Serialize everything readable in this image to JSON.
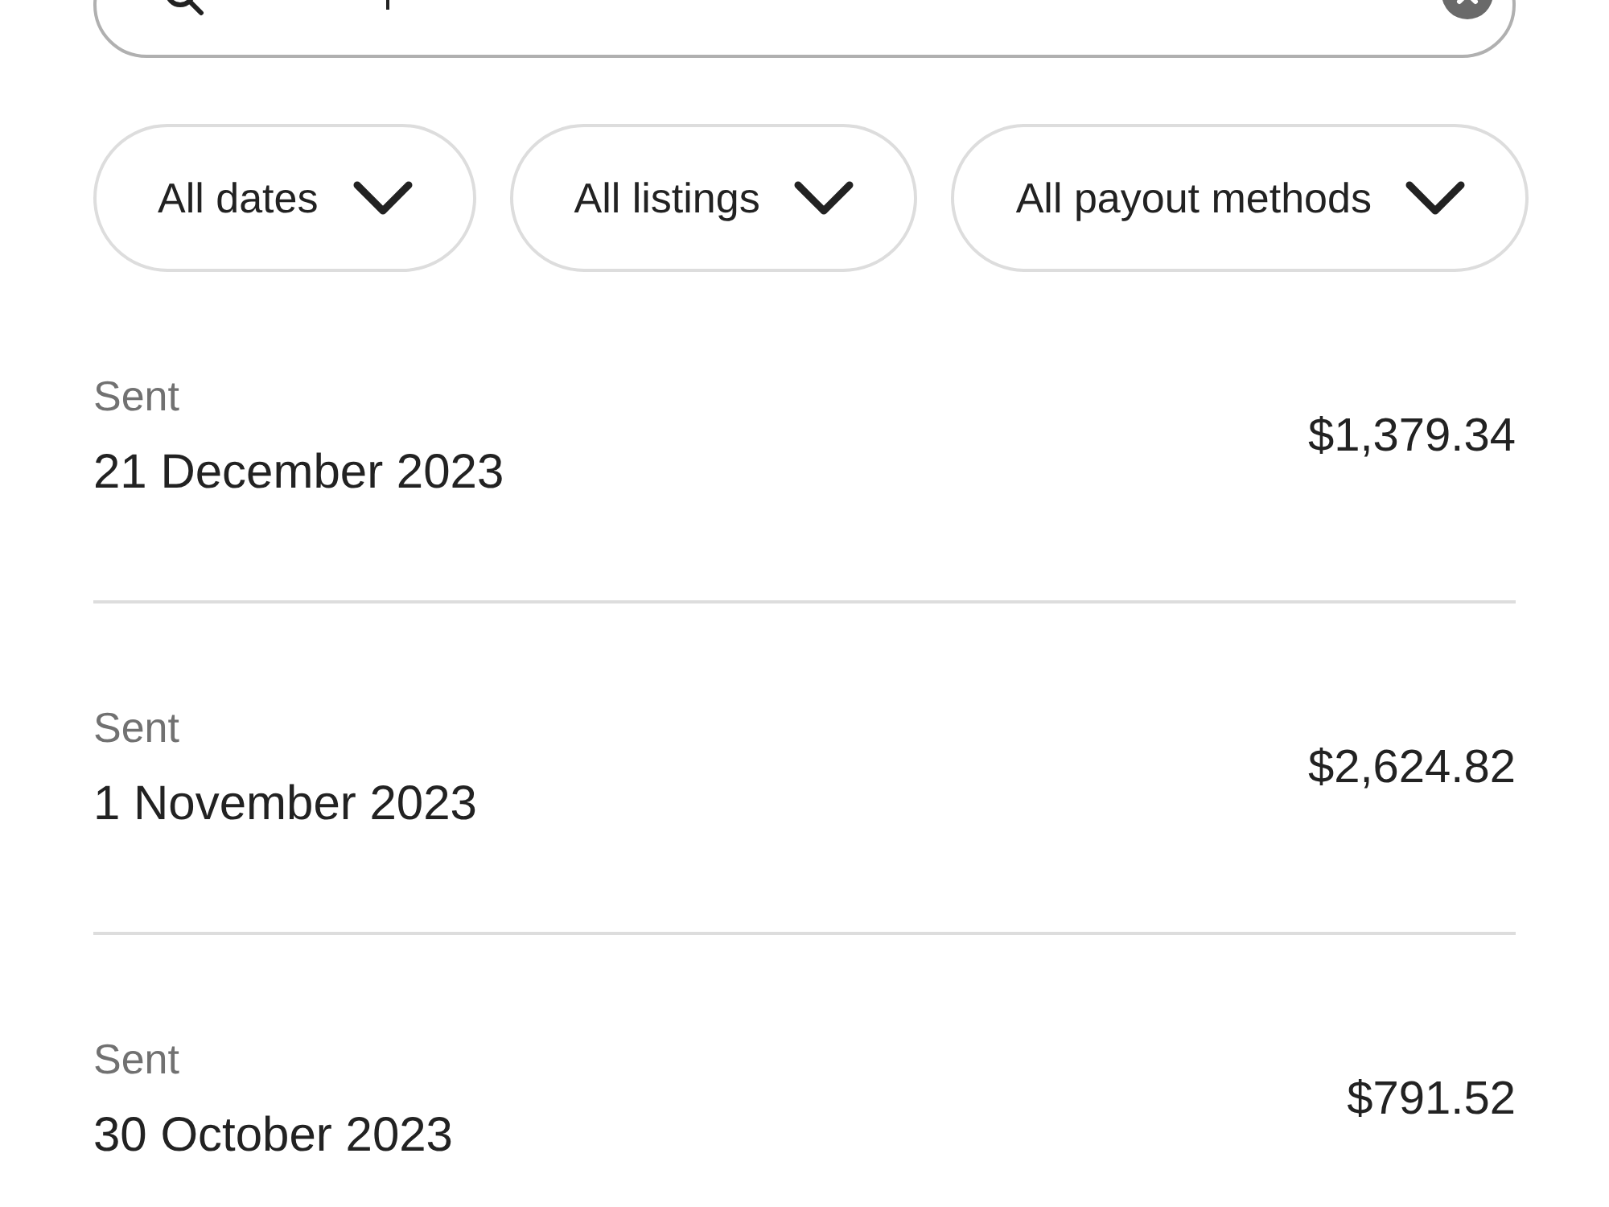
{
  "search": {
    "focused": true
  },
  "filters": [
    {
      "label": "All dates"
    },
    {
      "label": "All listings"
    },
    {
      "label": "All payout methods"
    }
  ],
  "payouts": [
    {
      "status": "Sent",
      "date": "21 December 2023",
      "amount": "$1,379.34"
    },
    {
      "status": "Sent",
      "date": "1 November 2023",
      "amount": "$2,624.82"
    },
    {
      "status": "Sent",
      "date": "30 October 2023",
      "amount": "$791.52"
    }
  ]
}
